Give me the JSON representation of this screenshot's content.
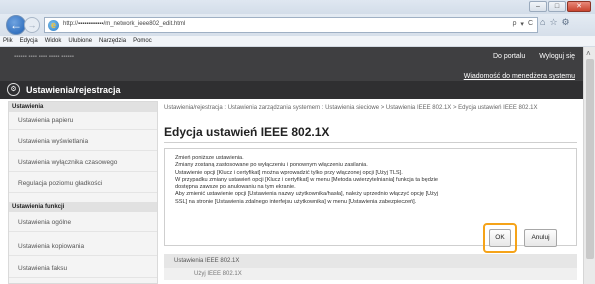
{
  "browser": {
    "window_controls": [
      "–",
      "□",
      "✕"
    ],
    "url": "http://▪▪▪▪▪▪▪▪▪▪▪▪/m_network_ieee802_edit.html",
    "address_tools": [
      "ρ",
      "▾",
      "C"
    ],
    "tab_icons": [
      "⌂",
      "☆",
      "⚙"
    ],
    "menu": [
      "Plik",
      "Edycja",
      "Widok",
      "Ulubione",
      "Narzędzia",
      "Pomoc"
    ]
  },
  "header": {
    "product_info": "▪▪▪▪▪▪   ▪▪▪▪ ▪▪▪▪  ▪▪▪▪▪ ▪▪▪▪▪▪",
    "portal_link": "Do portalu",
    "logout_link": "Wyloguj się",
    "message_link": "Wiadomość do menedżera systemu",
    "page_title": "Ustawienia/rejestracja",
    "page_icon": "⚙"
  },
  "sidebar": {
    "sections": [
      {
        "title": "Ustawienia",
        "items": [
          "Ustawienia papieru",
          "Ustawienia wyświetlania",
          "Ustawienia wyłącznika czasowego",
          "Regulacja poziomu gładkości"
        ]
      },
      {
        "title": "Ustawienia funkcji",
        "items": [
          "Ustawienia ogólne",
          "Ustawienia kopiowania",
          "Ustawienia faksu"
        ]
      }
    ]
  },
  "main": {
    "breadcrumb": "Ustawienia/rejestracja : Ustawienia zarządzania systemem : Ustawienia sieciowe > Ustawienia IEEE 802.1X > Edycja ustawień IEEE 802.1X",
    "title": "Edycja ustawień IEEE 802.1X",
    "info_lines": [
      "Zmień poniższe ustawienia.",
      "Zmiany zostaną zastosowane po wyłączeniu i ponownym włączeniu zasilania.",
      "Ustawienie opcji [Klucz i certyfikat] można wprowadzić tylko przy włączonej opcji [Użyj TLS].",
      "W przypadku zmiany ustawień opcji [Klucz i certyfikat] w menu [Metoda uwierzytelniania] funkcja ta będzie",
      "dostępna zawsze po anulowaniu na tym ekranie.",
      "Aby zmienić ustawienie opcji [Ustawienia nazwy użytkownika/hasła], należy uprzednio włączyć opcję [Użyj",
      "SSL] na stronie [Ustawienia zdalnego interfejsu użytkownika] w menu [Ustawienia zabezpieczeń]."
    ],
    "ok_label": "OK",
    "cancel_label": "Anuluj",
    "section_title": "Ustawienia IEEE 802.1X",
    "section_row": "Użyj IEEE 802.1X",
    "highlight_color": "#f5a319"
  }
}
